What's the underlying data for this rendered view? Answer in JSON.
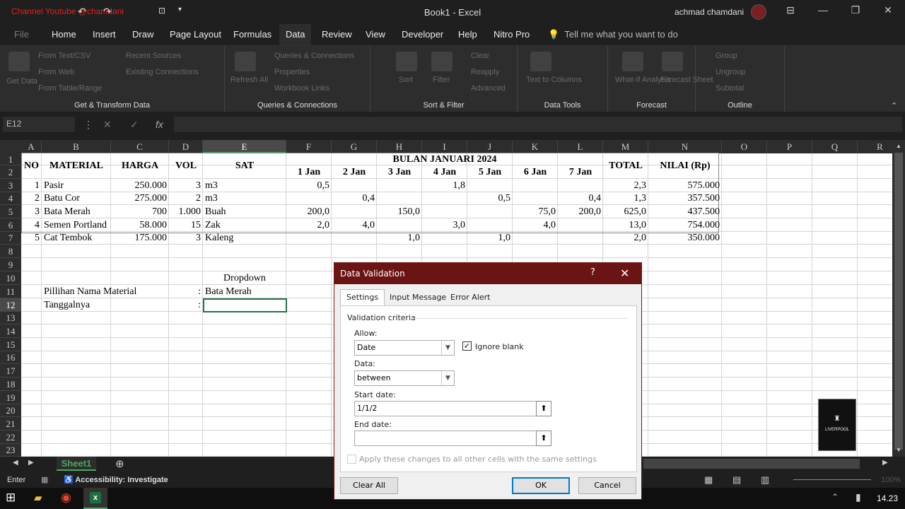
{
  "titlebar": {
    "channel": "Channel Youtube @chamdani",
    "title": "Book1  -  Excel",
    "user": "achmad chamdani"
  },
  "menu": [
    "File",
    "Home",
    "Insert",
    "Draw",
    "Page Layout",
    "Formulas",
    "Data",
    "Review",
    "View",
    "Developer",
    "Help",
    "Nitro Pro"
  ],
  "menu_active": "Data",
  "menu_search": "Tell me what you want to do",
  "ribbon": {
    "groups": [
      "Get & Transform Data",
      "Queries & Connections",
      "Sort & Filter",
      "Data Tools",
      "Forecast",
      "Outline"
    ],
    "items": {
      "get_data": "Get Data",
      "from_text": "From Text/CSV",
      "from_web": "From Web",
      "from_table": "From Table/Range",
      "recent_sources": "Recent Sources",
      "existing_conn": "Existing Connections",
      "refresh_all": "Refresh All",
      "queries_conn": "Queries & Connections",
      "properties": "Properties",
      "workbook_links": "Workbook Links",
      "sort": "Sort",
      "filter": "Filter",
      "clear": "Clear",
      "reapply": "Reapply",
      "advanced": "Advanced",
      "text_to_columns": "Text to Columns",
      "what_if": "What-If Analysis",
      "forecast_sheet": "Forecast Sheet",
      "group": "Group",
      "ungroup": "Ungroup",
      "subtotal": "Subtotal"
    }
  },
  "formula_bar": {
    "name_box": "E12",
    "fx": "fx",
    "formula": ""
  },
  "columns": [
    "A",
    "B",
    "C",
    "D",
    "E",
    "F",
    "G",
    "H",
    "I",
    "J",
    "K",
    "L",
    "M",
    "N",
    "O",
    "P",
    "Q",
    "R"
  ],
  "rows": [
    "1",
    "2",
    "3",
    "4",
    "5",
    "6",
    "7",
    "8",
    "9",
    "10",
    "11",
    "12",
    "13",
    "14",
    "15",
    "16",
    "17",
    "18",
    "19",
    "20",
    "21",
    "22",
    "23"
  ],
  "sheet": {
    "headers": {
      "no": "NO",
      "material": "MATERIAL",
      "harga": "HARGA",
      "vol": "VOL",
      "sat": "SAT",
      "bulan": "BULAN JANUARI 2024",
      "total": "TOTAL",
      "nilai": "NILAI (Rp)"
    },
    "days": [
      "1 Jan",
      "2 Jan",
      "3 Jan",
      "4 Jan",
      "5 Jan",
      "6 Jan",
      "7 Jan"
    ],
    "data": [
      {
        "no": "1",
        "material": "Pasir",
        "harga": "250.000",
        "vol": "3",
        "sat": "m3",
        "d": [
          "0,5",
          "",
          "",
          "1,8",
          "",
          "",
          ""
        ],
        "total": "2,3",
        "nilai": "575.000"
      },
      {
        "no": "2",
        "material": "Batu Cor",
        "harga": "275.000",
        "vol": "2",
        "sat": "m3",
        "d": [
          "",
          "0,4",
          "",
          "",
          "0,5",
          "",
          "0,4"
        ],
        "total": "1,3",
        "nilai": "357.500"
      },
      {
        "no": "3",
        "material": "Bata Merah",
        "harga": "700",
        "vol": "1.000",
        "sat": "Buah",
        "d": [
          "200,0",
          "",
          "150,0",
          "",
          "",
          "75,0",
          "200,0"
        ],
        "total": "625,0",
        "nilai": "437.500"
      },
      {
        "no": "4",
        "material": "Semen Portland",
        "harga": "58.000",
        "vol": "15",
        "sat": "Zak",
        "d": [
          "2,0",
          "4,0",
          "",
          "3,0",
          "",
          "4,0",
          ""
        ],
        "total": "13,0",
        "nilai": "754.000"
      },
      {
        "no": "5",
        "material": "Cat Tembok",
        "harga": "175.000",
        "vol": "3",
        "sat": "Kaleng",
        "d": [
          "",
          "",
          "1,0",
          "",
          "1,0",
          "",
          ""
        ],
        "total": "2,0",
        "nilai": "350.000"
      }
    ],
    "dropdown_label": "Dropdown",
    "pilihan_label": "Pillihan Nama Material",
    "colon": ":",
    "pilihan_value": "Bata Merah",
    "tanggal_label": "Tanggalnya"
  },
  "sheet_tab": "Sheet1",
  "status": {
    "mode": "Enter",
    "accessibility": "Accessibility: Investigate",
    "zoom": "100%"
  },
  "taskbar": {
    "time": "14.23"
  },
  "logo_text": "LIVERPOOL",
  "dialog": {
    "title": "Data Validation",
    "help": "?",
    "close": "✕",
    "tabs": [
      "Settings",
      "Input Message",
      "Error Alert"
    ],
    "section": "Validation criteria",
    "allow_label": "Allow:",
    "allow_value": "Date",
    "ignore_blank": "Ignore blank",
    "data_label": "Data:",
    "data_value": "between",
    "start_label": "Start date:",
    "start_value": "1/1/2",
    "end_label": "End date:",
    "end_value": "",
    "apply_all": "Apply these changes to all other cells with the same settings",
    "clear_all": "Clear All",
    "ok": "OK",
    "cancel": "Cancel"
  }
}
